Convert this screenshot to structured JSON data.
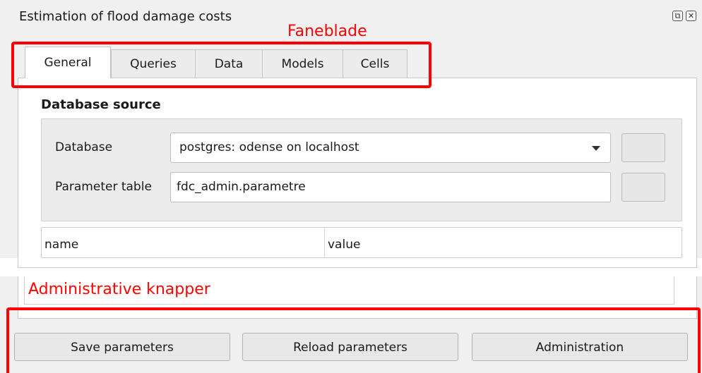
{
  "window": {
    "title": "Estimation of flood damage costs",
    "float_button": "⧉",
    "close_button": "✕"
  },
  "tabs": [
    {
      "label": "General",
      "active": true
    },
    {
      "label": "Queries",
      "active": false
    },
    {
      "label": "Data",
      "active": false
    },
    {
      "label": "Models",
      "active": false
    },
    {
      "label": "Cells",
      "active": false
    }
  ],
  "database_source": {
    "heading": "Database source",
    "database_label": "Database",
    "database_value": "postgres: odense on localhost",
    "parameter_table_label": "Parameter table",
    "parameter_table_value": "fdc_admin.parametre"
  },
  "parameter_table": {
    "columns": [
      "name",
      "value"
    ]
  },
  "buttons": {
    "save": "Save parameters",
    "reload": "Reload parameters",
    "administration": "Administration"
  },
  "annotations": {
    "tabs_label": "Faneblade",
    "buttons_label": "Administrative knapper",
    "color": "#ff0000"
  }
}
